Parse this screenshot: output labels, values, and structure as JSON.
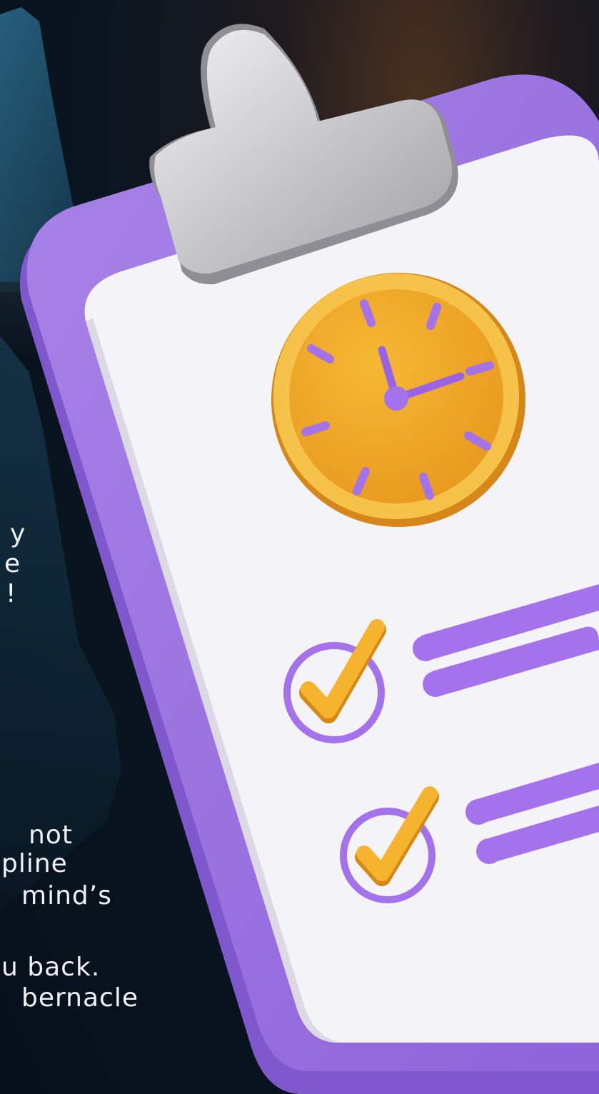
{
  "colors": {
    "background_dark": "#07121c",
    "board_purple": "#a37fe6",
    "board_purple_dark": "#7e58cc",
    "paper_white": "#f4f3f8",
    "clip_silver": "#c9c9cd",
    "clock_orange": "#f2ae2a",
    "accent_purple": "#a472ea",
    "check_yellow": "#f6b42e",
    "text_white": "#eef2f6"
  },
  "text_fragments": [
    "y",
    "e",
    "!",
    "not",
    "pline",
    "mind’s",
    "u back.",
    "bernacle"
  ],
  "illustration": {
    "subject": "clipboard checklist",
    "clock_icon": "clock-icon",
    "check_icon": "check-circle-icon",
    "checked_items": 2
  }
}
